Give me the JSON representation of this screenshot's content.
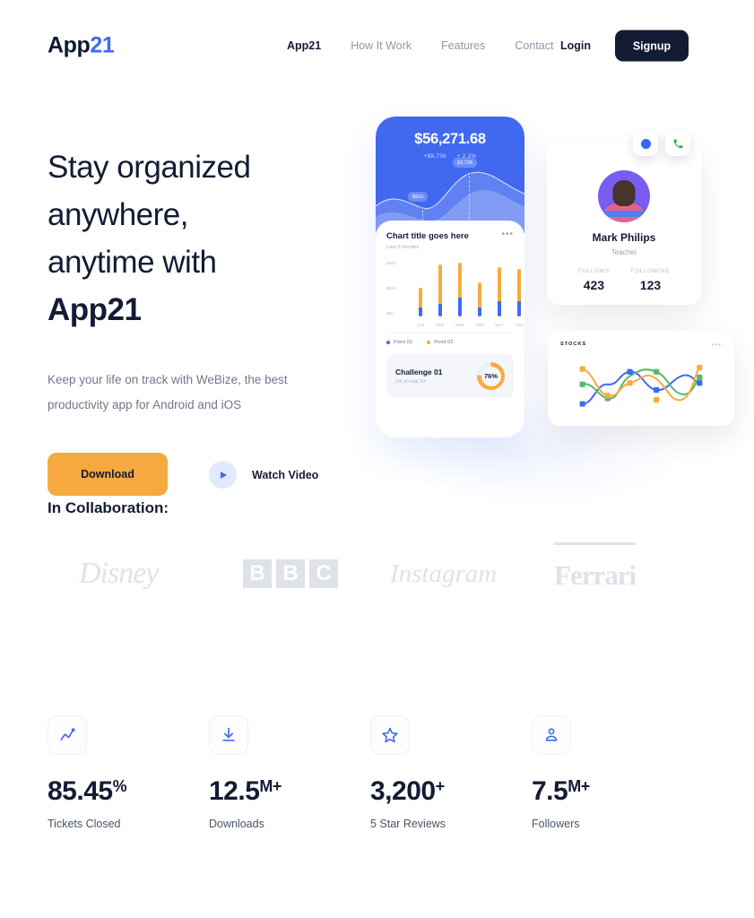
{
  "brand": {
    "name_prefix": "App",
    "name_suffix": "21",
    "accent_color": "#3e6bf6"
  },
  "nav": {
    "items": [
      {
        "label": "App21",
        "active": true
      },
      {
        "label": "How It Work",
        "active": false
      },
      {
        "label": "Features",
        "active": false
      },
      {
        "label": "Contact",
        "active": false
      }
    ],
    "login_label": "Login",
    "signup_label": "Signup"
  },
  "hero": {
    "title_line1": "Stay organized",
    "title_line2": "anywhere,",
    "title_line3": "anytime with",
    "title_strong": "App21",
    "subtitle": "Keep your life on track with WeBize, the best productivity app for Android and iOS",
    "download_label": "Download",
    "watch_label": "Watch Video",
    "collaboration_label": "In Collaboration:"
  },
  "brands": [
    {
      "name": "Disney",
      "label": "Disney"
    },
    {
      "name": "BBC",
      "letters": [
        "B",
        "B",
        "C"
      ]
    },
    {
      "name": "Instagram",
      "label": "Instagram"
    },
    {
      "name": "Ferrari",
      "label": "Ferrari"
    }
  ],
  "phone": {
    "balance": "$56,271.68",
    "balance_change_amount": "+$8,736",
    "balance_change_percent": "+ 2.3%",
    "tooltip_left": "$921",
    "tooltip_right": "$3,736",
    "chart_title": "Chart title goes here",
    "chart_subtitle": "Last 6 months",
    "menu_dots": "•••",
    "legend": [
      {
        "label": "Point 01",
        "color": "#3e6bf6"
      },
      {
        "label": "Point 02",
        "color": "#f7ab3e"
      }
    ],
    "challenge_title": "Challenge 01",
    "challenge_subtitle": "XX of total XX",
    "challenge_percent": "76%"
  },
  "profile": {
    "name": "Mark Philips",
    "role": "Teacher",
    "stats": [
      {
        "label": "FOLLOWS",
        "value": "423"
      },
      {
        "label": "FOLLOWING",
        "value": "123"
      }
    ]
  },
  "stocks": {
    "title": "STOCKS",
    "menu_dots": "•••"
  },
  "stats": [
    {
      "icon": "line-chart-icon",
      "value": "85.45",
      "suffix": "%",
      "label": "Tickets Closed"
    },
    {
      "icon": "download-icon",
      "value": "12.5",
      "suffix": "M+",
      "label": "Downloads"
    },
    {
      "icon": "star-icon",
      "value": "3,200",
      "suffix": "+",
      "label": "5 Star Reviews"
    },
    {
      "icon": "users-icon",
      "value": "7.5",
      "suffix": "M+",
      "label": "Followers"
    }
  ],
  "chart_data": [
    {
      "type": "bar",
      "title": "Chart title goes here",
      "subtitle": "Last 6 months",
      "categories": [
        "JAN",
        "FEB",
        "MAR",
        "APR",
        "MAY",
        "JUN"
      ],
      "ylabel": "",
      "xlabel": "",
      "ytick_labels": [
        "$30k",
        "$20k",
        "$1k"
      ],
      "ylim": [
        0,
        30
      ],
      "grid": false,
      "legend_position": "bottom-left",
      "stacked": true,
      "series": [
        {
          "name": "Point 01",
          "color": "#3e6bf6",
          "values": [
            4,
            6,
            9,
            4,
            7,
            7
          ]
        },
        {
          "name": "Point 02",
          "color": "#f7ab3e",
          "values": [
            9,
            22,
            21,
            12,
            18,
            17
          ]
        }
      ]
    },
    {
      "type": "area",
      "title": "$56,271.68",
      "annotations": [
        "$921",
        "$3,736"
      ],
      "values": [
        6,
        4,
        3,
        5,
        9,
        11,
        9,
        7
      ],
      "color": "#ffffff"
    },
    {
      "type": "line",
      "title": "STOCKS",
      "x": [
        0,
        1,
        2,
        3,
        4,
        5,
        6,
        7
      ],
      "series": [
        {
          "name": "blue",
          "color": "#4169f0",
          "values": [
            16,
            48,
            36,
            68,
            74,
            50,
            40,
            58
          ]
        },
        {
          "name": "green",
          "color": "#56b96a",
          "values": [
            52,
            40,
            26,
            52,
            78,
            72,
            46,
            62
          ]
        },
        {
          "name": "orange",
          "color": "#f7ab3e",
          "values": [
            72,
            42,
            30,
            70,
            76,
            18,
            36,
            76
          ]
        }
      ],
      "grid": false,
      "legend_position": "none"
    },
    {
      "type": "pie",
      "title": "Challenge 01",
      "values": [
        76,
        24
      ],
      "labels": [
        "complete",
        "remaining"
      ],
      "colors": [
        "#f7ab3e",
        "#eceff5"
      ],
      "annotation": "76%"
    }
  ]
}
